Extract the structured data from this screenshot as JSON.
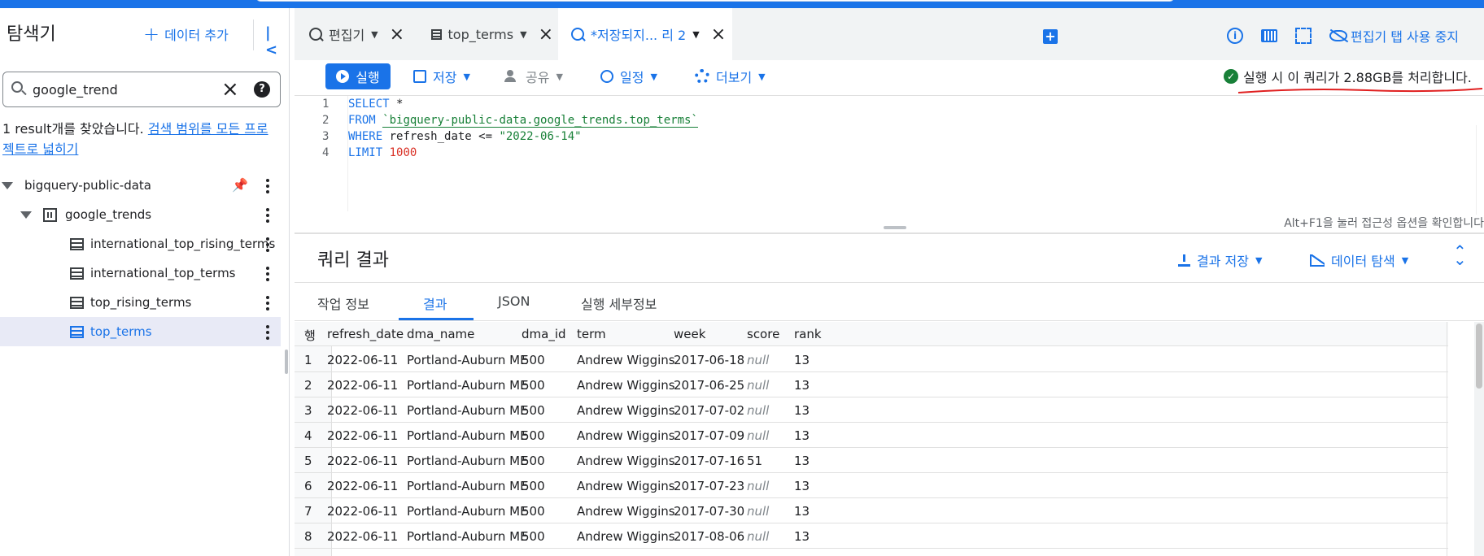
{
  "sidebar": {
    "title": "탐색기",
    "add_data_label": "데이터 추가",
    "search": {
      "value": "google_trend",
      "placeholder": ""
    },
    "result_note": "1 result개를 찾았습니다. ",
    "result_link": "검색 범위를 모든 프로젝트로 넓히기",
    "tree": [
      {
        "label": "bigquery-public-data",
        "type": "project"
      },
      {
        "label": "google_trends",
        "type": "dataset"
      },
      {
        "label": "international_top_rising_terms",
        "type": "table"
      },
      {
        "label": "international_top_terms",
        "type": "table"
      },
      {
        "label": "top_rising_terms",
        "type": "table"
      },
      {
        "label": "top_terms",
        "type": "table",
        "selected": true
      }
    ]
  },
  "tabs": [
    {
      "label": "편집기",
      "icon": "query-icon"
    },
    {
      "label": "top_terms",
      "icon": "table-icon"
    },
    {
      "label": "*저장되지... 리 2",
      "icon": "query-icon",
      "active": true
    }
  ],
  "tab_actions": {
    "hide_editor_label": "편집기 탭 사용 중지"
  },
  "toolbar": {
    "run_label": "실행",
    "save_label": "저장",
    "share_label": "공유",
    "schedule_label": "일정",
    "more_label": "더보기"
  },
  "status": {
    "text": "실행 시 이 쿼리가 2.88GB를 처리합니다."
  },
  "editor": {
    "line_numbers": [
      "1",
      "2",
      "3",
      "4"
    ],
    "lines": {
      "l1_kw": "SELECT",
      "l1_rest": " *",
      "l2_kw": "FROM",
      "l2_table": "`bigquery-public-data.google_trends.top_terms`",
      "l3_kw": "WHERE",
      "l3_rest": " refresh_date <= ",
      "l3_str": "\"2022-06-14\"",
      "l4_kw": "LIMIT",
      "l4_num": " 1000"
    },
    "hint": "Alt+F1을 눌러 접근성 옵션을 확인합니다"
  },
  "results": {
    "title": "쿼리 결과",
    "save_results_label": "결과 저장",
    "explore_label": "데이터 탐색",
    "tabs": [
      "작업 정보",
      "결과",
      "JSON",
      "실행 세부정보"
    ],
    "active_tab": "결과",
    "columns": [
      "행",
      "refresh_date",
      "dma_name",
      "dma_id",
      "term",
      "week",
      "score",
      "rank"
    ],
    "rows": [
      [
        "1",
        "2022-06-11",
        "Portland-Auburn ME",
        "500",
        "Andrew Wiggins",
        "2017-06-18",
        "null",
        "13"
      ],
      [
        "2",
        "2022-06-11",
        "Portland-Auburn ME",
        "500",
        "Andrew Wiggins",
        "2017-06-25",
        "null",
        "13"
      ],
      [
        "3",
        "2022-06-11",
        "Portland-Auburn ME",
        "500",
        "Andrew Wiggins",
        "2017-07-02",
        "null",
        "13"
      ],
      [
        "4",
        "2022-06-11",
        "Portland-Auburn ME",
        "500",
        "Andrew Wiggins",
        "2017-07-09",
        "null",
        "13"
      ],
      [
        "5",
        "2022-06-11",
        "Portland-Auburn ME",
        "500",
        "Andrew Wiggins",
        "2017-07-16",
        "51",
        "13"
      ],
      [
        "6",
        "2022-06-11",
        "Portland-Auburn ME",
        "500",
        "Andrew Wiggins",
        "2017-07-23",
        "null",
        "13"
      ],
      [
        "7",
        "2022-06-11",
        "Portland-Auburn ME",
        "500",
        "Andrew Wiggins",
        "2017-07-30",
        "null",
        "13"
      ],
      [
        "8",
        "2022-06-11",
        "Portland-Auburn ME",
        "500",
        "Andrew Wiggins",
        "2017-08-06",
        "null",
        "13"
      ]
    ]
  },
  "colors": {
    "accent": "#1a73e8",
    "success": "#188038",
    "annotation": "#e02020"
  }
}
